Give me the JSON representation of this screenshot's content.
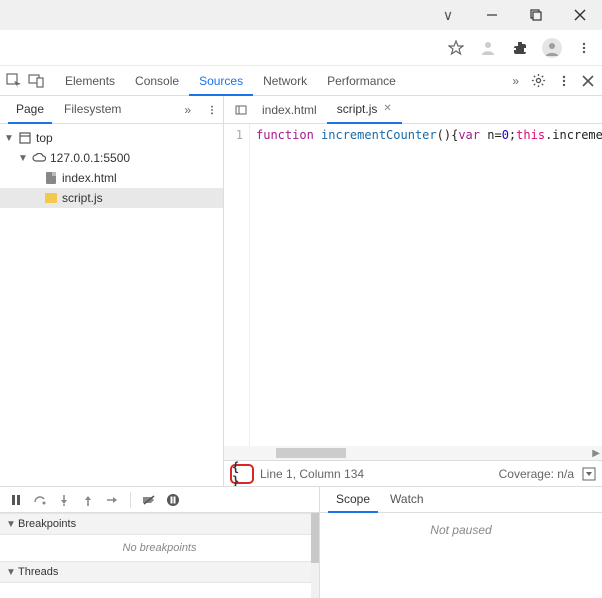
{
  "devtools": {
    "tabs": [
      "Elements",
      "Console",
      "Sources",
      "Network",
      "Performance"
    ],
    "active_tab": "Sources"
  },
  "navigator": {
    "tabs": {
      "page": "Page",
      "filesystem": "Filesystem"
    },
    "tree": {
      "top": "top",
      "host": "127.0.0.1:5500",
      "files": {
        "index": "index.html",
        "script": "script.js"
      }
    }
  },
  "editor": {
    "tabs": {
      "index": "index.html",
      "script": "script.js"
    },
    "gutter_line": "1",
    "code": {
      "kw_function": "function",
      "fn_name": " incrementCounter",
      "paren_open": "(){",
      "kw_var": "var",
      "var_n": " n",
      "eq": "=",
      "zero": "0",
      "semi": ";",
      "this_": "this",
      "dot": ".",
      "prop": "increment"
    }
  },
  "status": {
    "pretty": "{ }",
    "cursor": "Line 1, Column 134",
    "coverage": "Coverage: n/a"
  },
  "debugger": {
    "sections": {
      "breakpoints": "Breakpoints",
      "threads": "Threads"
    },
    "no_breakpoints": "No breakpoints",
    "right_tabs": {
      "scope": "Scope",
      "watch": "Watch"
    },
    "not_paused": "Not paused"
  }
}
